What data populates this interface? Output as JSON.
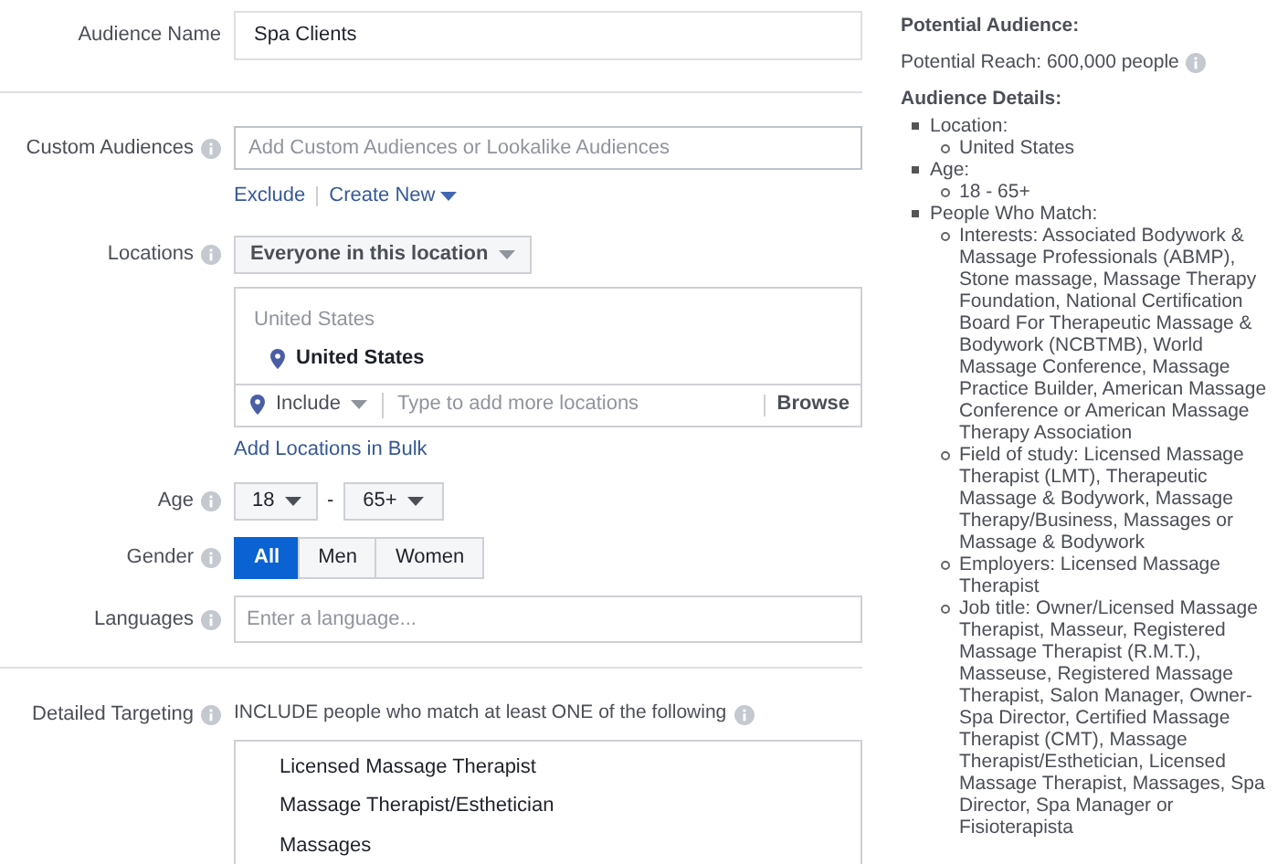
{
  "audience_name": {
    "label": "Audience Name",
    "value": "Spa Clients"
  },
  "custom_audiences": {
    "label": "Custom Audiences",
    "placeholder": "Add Custom Audiences or Lookalike Audiences",
    "links": [
      "Exclude",
      "Create New"
    ]
  },
  "locations": {
    "label": "Locations",
    "mode": "Everyone in this location",
    "group": "United States",
    "items": [
      "United States"
    ],
    "include": "Include",
    "placeholder": "Type to add more locations",
    "browse": "Browse",
    "bulk_link": "Add Locations in Bulk"
  },
  "age": {
    "label": "Age",
    "min": "18",
    "separator": "-",
    "max": "65+"
  },
  "gender": {
    "label": "Gender",
    "options": [
      {
        "label": "All",
        "selected": true
      },
      {
        "label": "Men",
        "selected": false
      },
      {
        "label": "Women",
        "selected": false
      }
    ]
  },
  "languages": {
    "label": "Languages",
    "placeholder": "Enter a language..."
  },
  "detailed_targeting": {
    "label": "Detailed Targeting",
    "hint": "INCLUDE people who match at least ONE of the following",
    "items": [
      "Licensed Massage Therapist",
      "Massage Therapist/Esthetician",
      "Massages"
    ]
  },
  "potential_audience": {
    "title": "Potential Audience:",
    "reach": "Potential Reach: 600,000 people",
    "details_title": "Audience Details:",
    "details": [
      {
        "text": "Location:",
        "children": [
          {
            "text": "United States"
          }
        ]
      },
      {
        "text": "Age:",
        "children": [
          {
            "text": "18 - 65+"
          }
        ]
      },
      {
        "text": "People Who Match:",
        "children": [
          {
            "text": "Interests: Associated Bodywork & Massage Professionals (ABMP), Stone massage, Massage Therapy Foundation, National Certification Board For Therapeutic Massage & Bodywork (NCBTMB), World Massage Conference, Massage Practice Builder, American Massage Conference or American Massage Therapy Association"
          },
          {
            "text": "Field of study: Licensed Massage Therapist (LMT), Therapeutic Massage & Bodywork, Massage Therapy/Business, Massages or Massage & Bodywork"
          },
          {
            "text": "Employers: Licensed Massage Therapist"
          },
          {
            "text": "Job title: Owner/Licensed Massage Therapist, Masseur, Registered Massage Therapist (R.M.T.), Masseuse, Registered Massage Therapist, Salon Manager, Owner-Spa Director, Certified Massage Therapist (CMT), Massage Therapist/Esthetician, Licensed Massage Therapist, Massages, Spa Director, Spa Manager or Fisioterapista"
          }
        ]
      }
    ]
  }
}
